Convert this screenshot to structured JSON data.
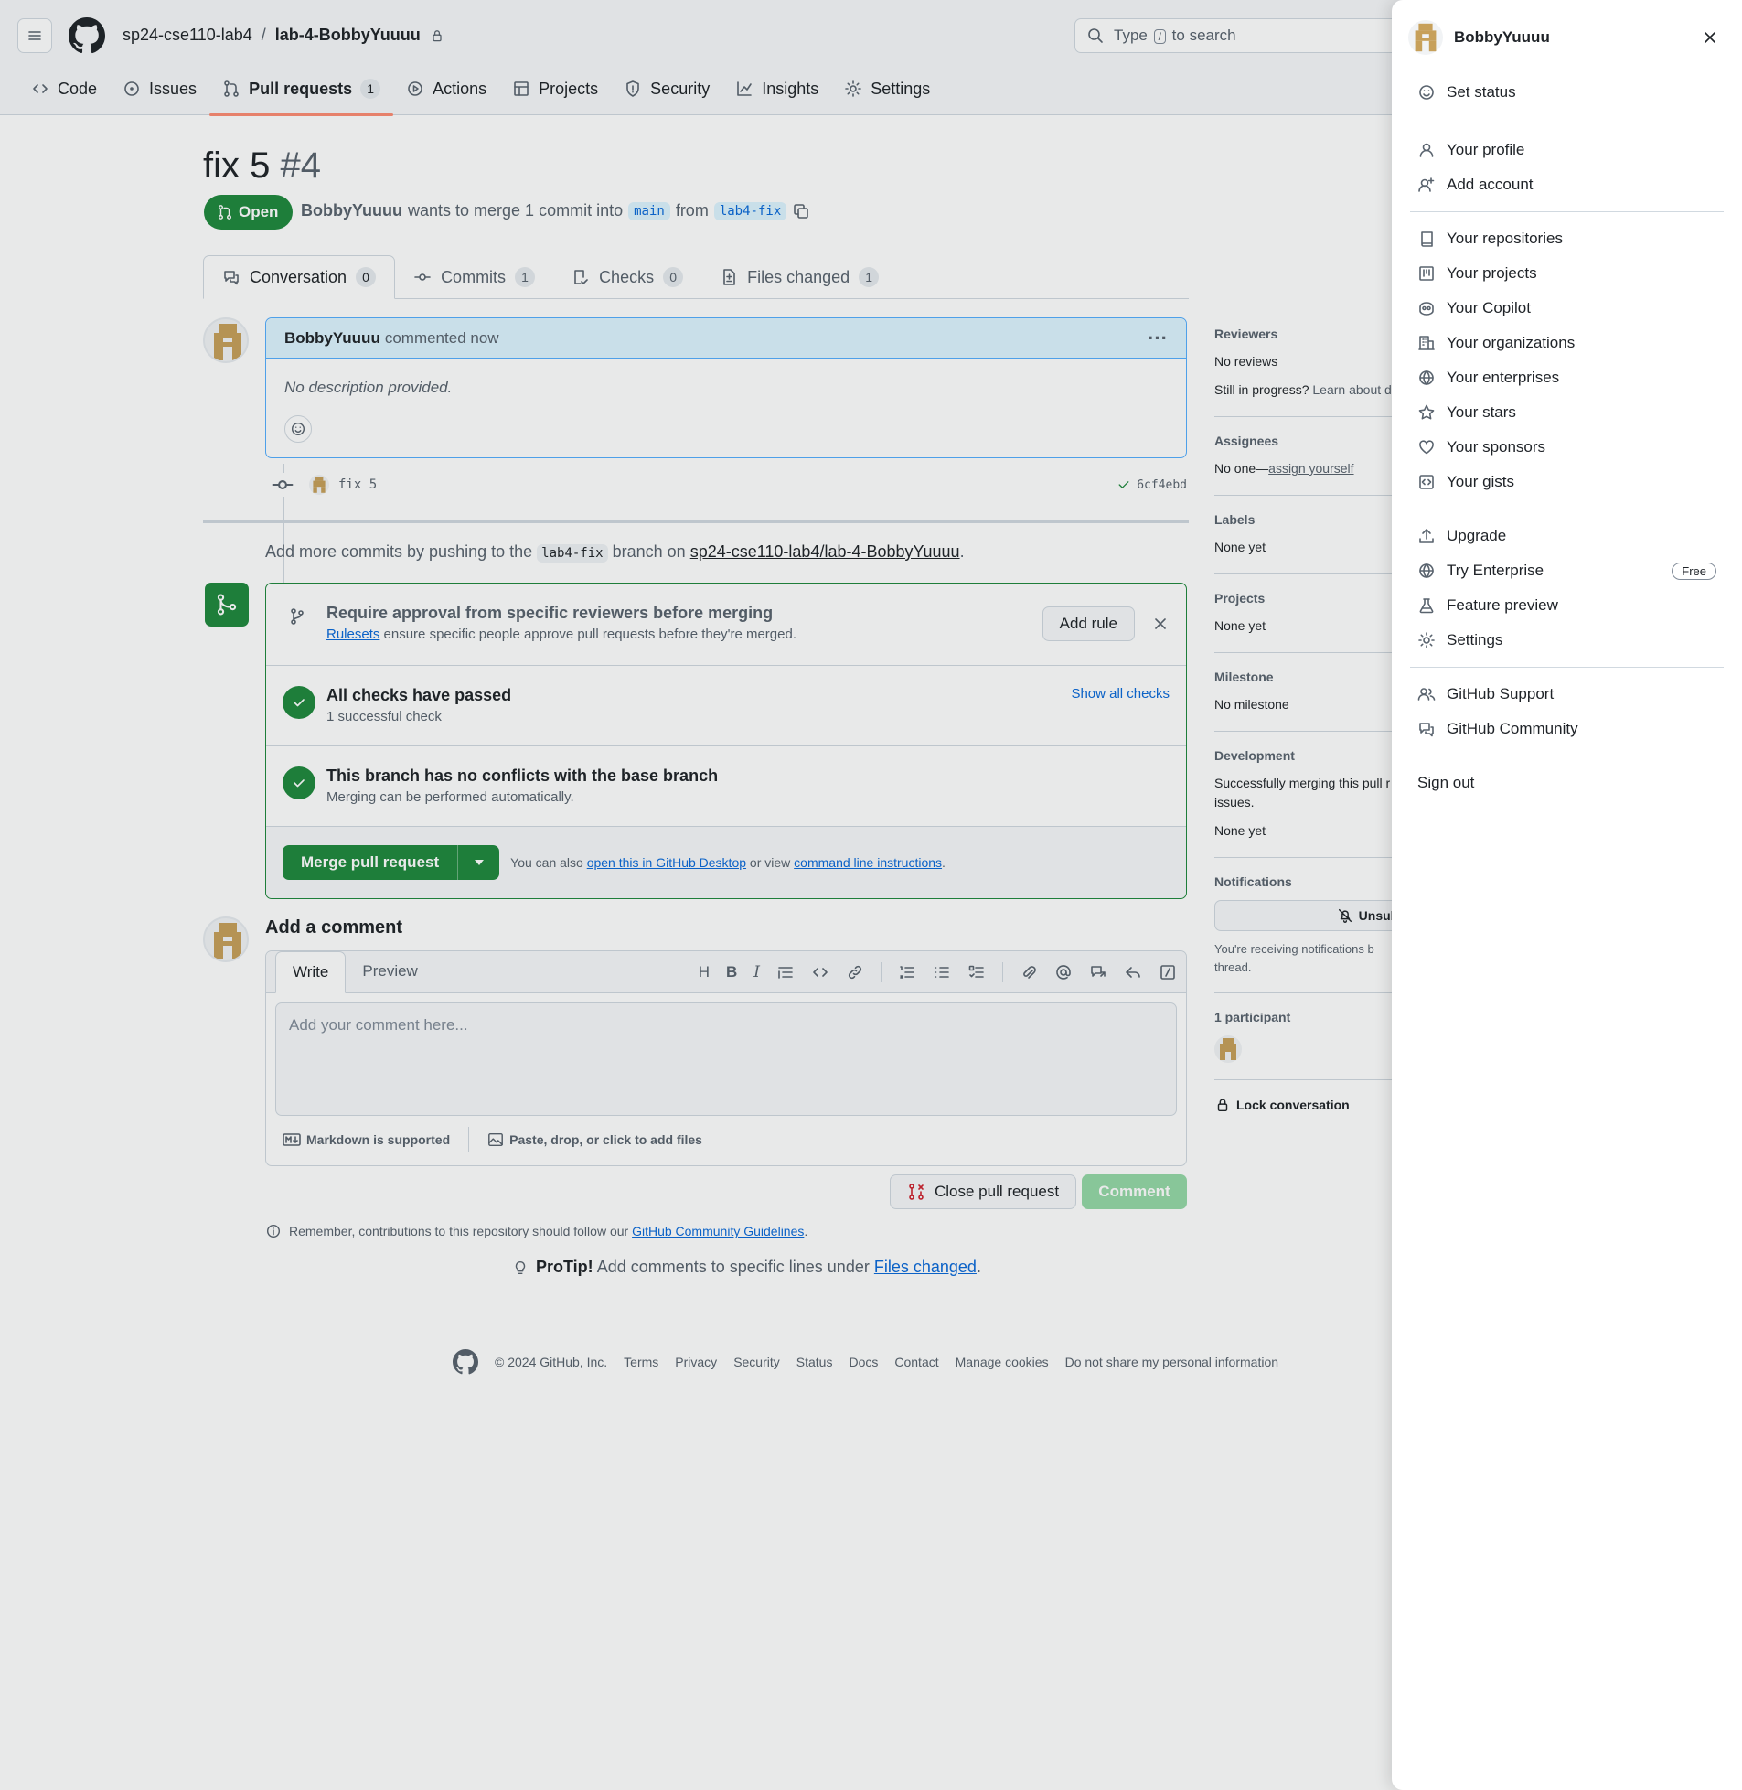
{
  "header": {
    "owner": "sp24-cse110-lab4",
    "separator": "/",
    "repo": "lab-4-BobbyYuuuu",
    "search_prefix": "Type",
    "search_key": "/",
    "search_suffix": "to search"
  },
  "repo_nav": {
    "code": "Code",
    "issues": "Issues",
    "pull_requests": "Pull requests",
    "pull_requests_count": "1",
    "actions": "Actions",
    "projects": "Projects",
    "security": "Security",
    "insights": "Insights",
    "settings": "Settings"
  },
  "pr": {
    "title": "fix 5",
    "number": "#4",
    "state": "Open",
    "author": "BobbyYuuuu",
    "merge_text": "wants to merge 1 commit into",
    "base": "main",
    "from": "from",
    "head": "lab4-fix"
  },
  "pr_tabs": {
    "conversation": "Conversation",
    "conversation_count": "0",
    "commits": "Commits",
    "commits_count": "1",
    "checks": "Checks",
    "checks_count": "0",
    "files": "Files changed",
    "files_count": "1"
  },
  "comment": {
    "author": "BobbyYuuuu",
    "when": "commented now",
    "body": "No description provided.",
    "more": "···"
  },
  "commit": {
    "message": "fix 5",
    "sha": "6cf4ebd"
  },
  "addmore": {
    "prefix": "Add more commits by pushing to the",
    "branch": "lab4-fix",
    "middle": "branch on",
    "repo": "sp24-cse110-lab4/lab-4-BobbyYuuuu",
    "end": "."
  },
  "merge": {
    "rule_title": "Require approval from specific reviewers before merging",
    "rule_link": "Rulesets",
    "rule_sub": "ensure specific people approve pull requests before they're merged.",
    "add_rule": "Add rule",
    "checks_title": "All checks have passed",
    "checks_sub": "1 successful check",
    "show_checks": "Show all checks",
    "conflict_title": "This branch has no conflicts with the base branch",
    "conflict_sub": "Merging can be performed automatically.",
    "merge_button": "Merge pull request",
    "also": "You can also",
    "desktop_link": "open this in GitHub Desktop",
    "or_view": "or view",
    "cli_link": "command line instructions",
    "end": "."
  },
  "editor": {
    "title": "Add a comment",
    "write": "Write",
    "preview": "Preview",
    "placeholder": "Add your comment here...",
    "markdown": "Markdown is supported",
    "files": "Paste, drop, or click to add files"
  },
  "actions": {
    "close": "Close pull request",
    "comment": "Comment"
  },
  "remember": {
    "text": "Remember, contributions to this repository should follow our",
    "link": "GitHub Community Guidelines",
    "end": "."
  },
  "protip": {
    "label": "ProTip!",
    "text": "Add comments to specific lines under",
    "link": "Files changed",
    "end": "."
  },
  "footer": {
    "copyright": "© 2024 GitHub, Inc.",
    "terms": "Terms",
    "privacy": "Privacy",
    "security": "Security",
    "status": "Status",
    "docs": "Docs",
    "contact": "Contact",
    "cookies": "Manage cookies",
    "dns": "Do not share my personal information"
  },
  "sidebar": {
    "reviewers_h": "Reviewers",
    "reviewers_v": "No reviews",
    "progress": "Still in progress?",
    "learn": "Learn about d",
    "assignees_h": "Assignees",
    "assignees_v": "No one—",
    "assign_link": "assign yourself",
    "labels_h": "Labels",
    "labels_v": "None yet",
    "projects_h": "Projects",
    "projects_v": "None yet",
    "milestone_h": "Milestone",
    "milestone_v": "No milestone",
    "dev_h": "Development",
    "dev_v": "Successfully merging this pull r",
    "dev_v2": "issues.",
    "dev_v3": "None yet",
    "notif_h": "Notifications",
    "unsub": "Unsubs",
    "notif_v": "You're receiving notifications b",
    "notif_v2": "thread.",
    "participants_h": "1 participant",
    "lock": "Lock conversation"
  },
  "menu": {
    "user": "BobbyYuuuu",
    "set_status": "Set status",
    "profile": "Your profile",
    "add_account": "Add account",
    "repos": "Your repositories",
    "projects": "Your projects",
    "copilot": "Your Copilot",
    "orgs": "Your organizations",
    "enterprises": "Your enterprises",
    "stars": "Your stars",
    "sponsors": "Your sponsors",
    "gists": "Your gists",
    "upgrade": "Upgrade",
    "enterprise": "Try Enterprise",
    "free": "Free",
    "feature": "Feature preview",
    "settings": "Settings",
    "support": "GitHub Support",
    "community": "GitHub Community",
    "signout": "Sign out"
  },
  "colors": {
    "accent": "#0969da",
    "success": "#1f883d",
    "tab_underline": "#fd8c73"
  }
}
